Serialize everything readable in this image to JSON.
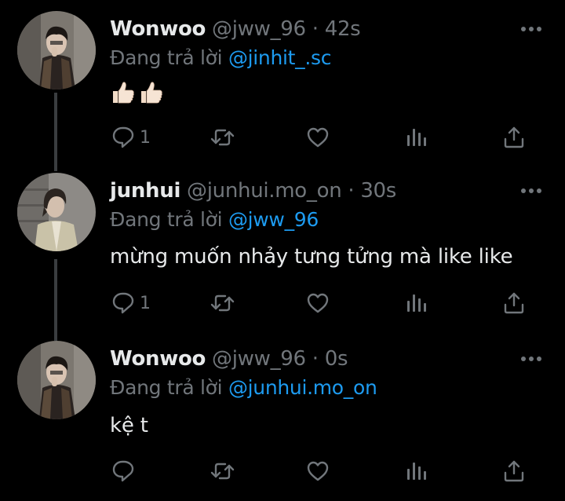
{
  "tweets": [
    {
      "name": "Wonwoo",
      "handle": "@jww_96",
      "separator": "·",
      "time": "42s",
      "reply_prefix": "Đang trả lời ",
      "reply_to": "@jinhit_.sc",
      "text": "",
      "emoji": [
        "thumbs-up-light-skin",
        "thumbs-up-light-skin"
      ],
      "reply_count": "1",
      "avatar": "wonwoo-avatar"
    },
    {
      "name": "junhui",
      "handle": "@junhui.mo_on",
      "separator": "·",
      "time": "30s",
      "reply_prefix": "Đang trả lời ",
      "reply_to": "@jww_96",
      "text": "mừng muốn nhảy tưng tửng mà like like",
      "reply_count": "1",
      "avatar": "junhui-avatar"
    },
    {
      "name": "Wonwoo",
      "handle": "@jww_96",
      "separator": "·",
      "time": "0s",
      "reply_prefix": "Đang trả lời ",
      "reply_to": "@junhui.mo_on",
      "text": "kệ t",
      "reply_count": "",
      "avatar": "wonwoo-avatar"
    }
  ],
  "colors": {
    "background": "#000000",
    "text": "#e7e9ea",
    "secondary": "#71767b",
    "link": "#1d9bf0",
    "thread_line": "#3a3d40"
  },
  "icons": [
    "reply-icon",
    "retweet-icon",
    "like-icon",
    "views-icon",
    "share-icon",
    "more-icon"
  ]
}
